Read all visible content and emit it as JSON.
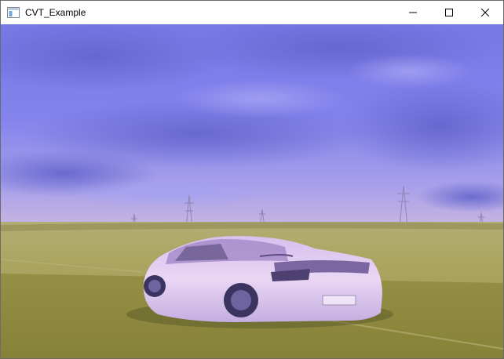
{
  "window": {
    "title": "CVT_Example",
    "controls": [
      {
        "name": "minimize",
        "icon": "minimize-icon"
      },
      {
        "name": "maximize",
        "icon": "maximize-icon"
      },
      {
        "name": "close",
        "icon": "close-icon"
      }
    ]
  },
  "image": {
    "description_icon": "photo-icon",
    "license_plate": "",
    "colors": {
      "sky": "#7f80e8",
      "cloud_dark": "#6a6ad0",
      "horizon": "#b9a8e4",
      "ground": "#a3a35a",
      "road": "#8c8a40",
      "car_body": "#e0c8f0",
      "car_shadow": "#8a78b0"
    }
  }
}
